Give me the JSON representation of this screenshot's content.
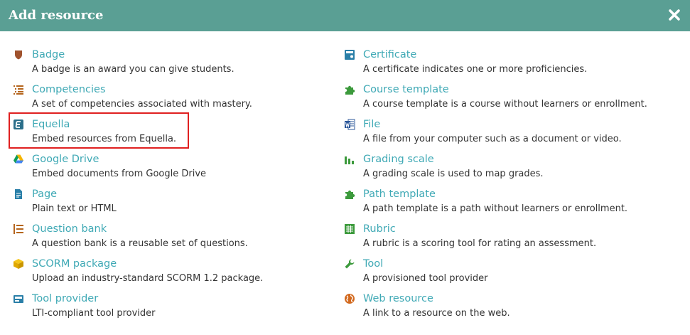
{
  "dialog": {
    "title": "Add resource",
    "close_icon": "close-icon"
  },
  "left_items": [
    {
      "icon": "badge-icon",
      "name": "Badge",
      "description": "A badge is an award you can give students."
    },
    {
      "icon": "competencies-icon",
      "name": "Competencies",
      "description": "A set of competencies associated with mastery."
    },
    {
      "icon": "equella-icon",
      "name": "Equella",
      "description": "Embed resources from Equella."
    },
    {
      "icon": "google-drive-icon",
      "name": "Google Drive",
      "description": "Embed documents from Google Drive"
    },
    {
      "icon": "page-icon",
      "name": "Page",
      "description": "Plain text or HTML"
    },
    {
      "icon": "question-bank-icon",
      "name": "Question bank",
      "description": "A question bank is a reusable set of questions."
    },
    {
      "icon": "scorm-package-icon",
      "name": "SCORM package",
      "description": "Upload an industry-standard SCORM 1.2 package."
    },
    {
      "icon": "tool-provider-icon",
      "name": "Tool provider",
      "description": "LTI-compliant tool provider"
    }
  ],
  "right_items": [
    {
      "icon": "certificate-icon",
      "name": "Certificate",
      "description": "A certificate indicates one or more proficiencies."
    },
    {
      "icon": "puzzle-icon",
      "name": "Course template",
      "description": "A course template is a course without learners or enrollment."
    },
    {
      "icon": "word-file-icon",
      "name": "File",
      "description": "A file from your computer such as a document or video."
    },
    {
      "icon": "bar-chart-icon",
      "name": "Grading scale",
      "description": "A grading scale is used to map grades."
    },
    {
      "icon": "puzzle-icon",
      "name": "Path template",
      "description": "A path template is a path without learners or enrollment."
    },
    {
      "icon": "rubric-grid-icon",
      "name": "Rubric",
      "description": "A rubric is a scoring tool for rating an assessment."
    },
    {
      "icon": "wrench-icon",
      "name": "Tool",
      "description": "A provisioned tool provider"
    },
    {
      "icon": "globe-icon",
      "name": "Web resource",
      "description": "A link to a resource on the web."
    }
  ],
  "colors": {
    "header": "#5a9f94",
    "link": "#3fa9b5",
    "highlight": "#e02020"
  }
}
